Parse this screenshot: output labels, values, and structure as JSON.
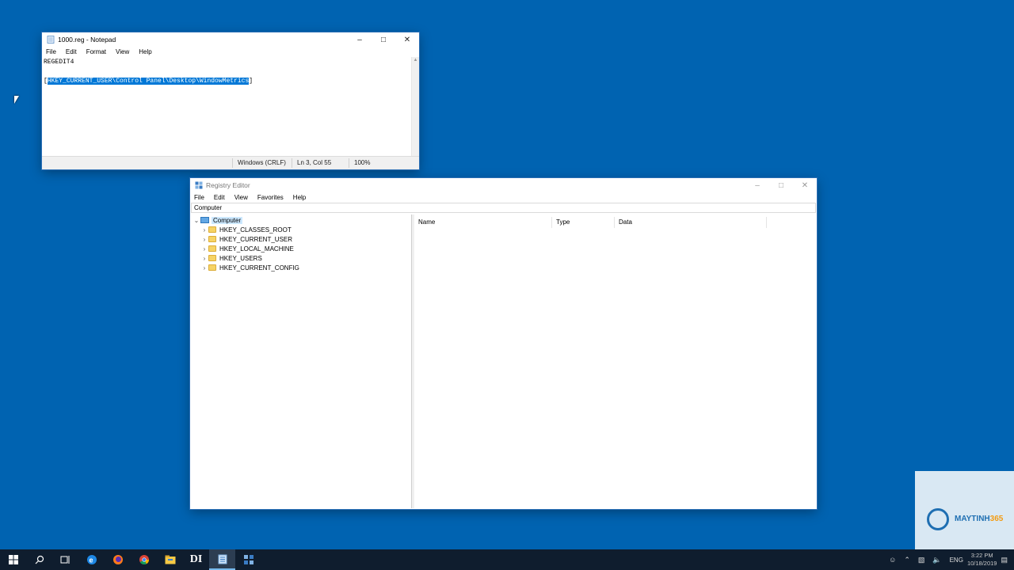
{
  "notepad": {
    "title": "1000.reg - Notepad",
    "menu": [
      "File",
      "Edit",
      "Format",
      "View",
      "Help"
    ],
    "lines": [
      "REGEDIT4",
      "",
      "[HKEY_CURRENT_USER\\Control Panel\\Desktop\\WindowMetrics]"
    ],
    "selected_text": "HKEY_CURRENT_USER\\Control Panel\\Desktop\\WindowMetrics",
    "status": {
      "line_ending": "Windows (CRLF)",
      "position": "Ln 3, Col 55",
      "zoom": "100%"
    }
  },
  "regedit": {
    "title": "Registry Editor",
    "menu": [
      "File",
      "Edit",
      "View",
      "Favorites",
      "Help"
    ],
    "address": "Computer",
    "tree": {
      "root": "Computer",
      "children": [
        "HKEY_CLASSES_ROOT",
        "HKEY_CURRENT_USER",
        "HKEY_LOCAL_MACHINE",
        "HKEY_USERS",
        "HKEY_CURRENT_CONFIG"
      ]
    },
    "columns": [
      "Name",
      "Type",
      "Data"
    ]
  },
  "taskbar": {
    "apps": [
      "start-icon",
      "search-icon",
      "task-view-icon",
      "edge-icon",
      "firefox-icon",
      "chrome-icon",
      "file-explorer-icon",
      "di-app-icon",
      "notepad-icon",
      "regedit-icon"
    ],
    "tray": {
      "language": "ENG",
      "time": "3:22 PM",
      "date": "10/18/2019"
    }
  },
  "watermark": {
    "brand_a": "MAYTINH",
    "brand_b": "365"
  }
}
